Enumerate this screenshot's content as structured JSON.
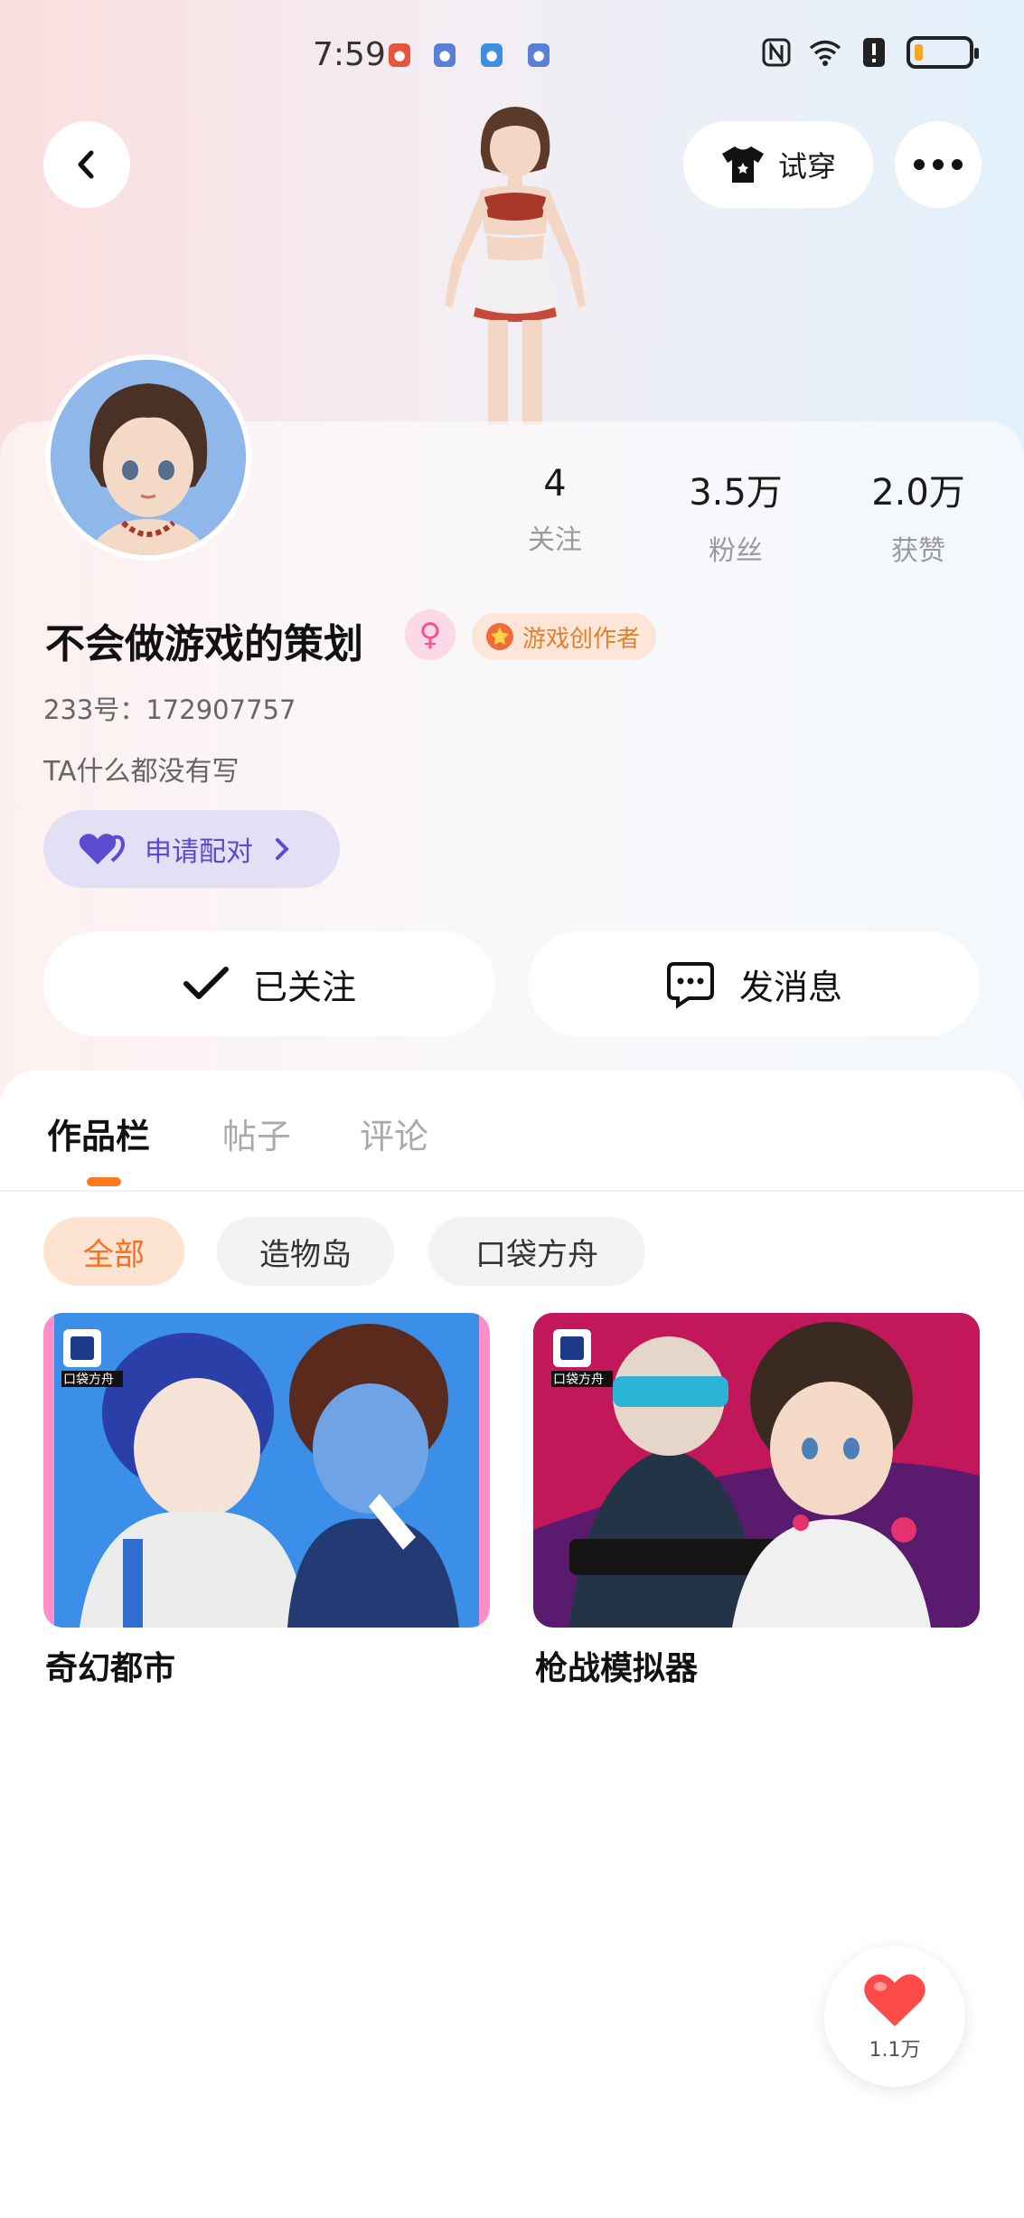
{
  "status_bar": {
    "time": "7:59",
    "notifications": [
      {
        "icon": "app-notification-icon",
        "color": "#e8553d"
      },
      {
        "icon": "app-notification-icon",
        "color": "#5b7fd6"
      },
      {
        "icon": "app-notification-icon",
        "color": "#3f8de0"
      },
      {
        "icon": "app-notification-icon",
        "color": "#5b7fd6"
      }
    ],
    "battery_level": 0.15,
    "battery_color": "#f5a623"
  },
  "header": {
    "back_icon": "chevron-left-icon",
    "try_on_label": "试穿",
    "try_on_icon": "tshirt-icon",
    "more_icon": "more-horizontal-icon"
  },
  "profile": {
    "name": "不会做游戏的策划",
    "gender_icon": "female-icon",
    "badge_label": "游戏创作者",
    "uid_label": "233号：",
    "uid": "172907757",
    "bio": "TA什么都没有写",
    "match_label": "申请配对",
    "stats": [
      {
        "value": "4",
        "label": "关注"
      },
      {
        "value": "3.5万",
        "label": "粉丝"
      },
      {
        "value": "2.0万",
        "label": "获赞"
      }
    ]
  },
  "actions": {
    "follow_label": "已关注",
    "message_label": "发消息"
  },
  "tabs": [
    {
      "label": "作品栏",
      "active": true
    },
    {
      "label": "帖子",
      "active": false
    },
    {
      "label": "评论",
      "active": false
    }
  ],
  "filters": [
    {
      "label": "全部",
      "active": true
    },
    {
      "label": "造物岛",
      "active": false
    },
    {
      "label": "口袋方舟",
      "active": false
    }
  ],
  "games": [
    {
      "title": "奇幻都市",
      "logo_text": "口袋方舟"
    },
    {
      "title": "枪战模拟器",
      "logo_text": "口袋方舟"
    }
  ],
  "like": {
    "count": "1.1万",
    "icon": "heart-icon",
    "color": "#ff4a4a"
  },
  "colors": {
    "accent": "#ff7a1a",
    "match": "#5a4bd0",
    "badge": "#e0812f"
  }
}
